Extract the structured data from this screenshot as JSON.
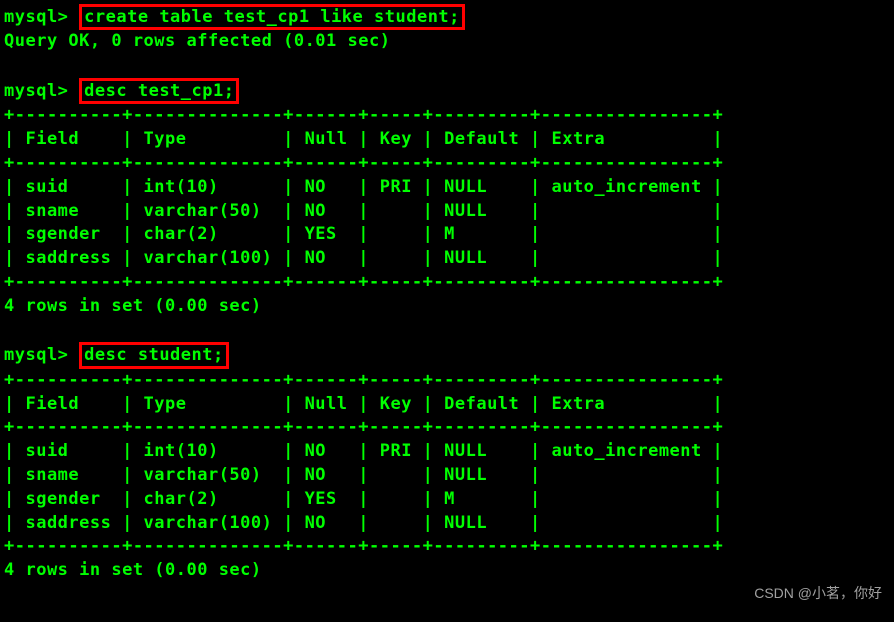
{
  "prompt": "mysql>",
  "commands": {
    "cmd1": "create table test_cp1 like student;",
    "cmd2": "desc test_cp1;",
    "cmd3": "desc student;"
  },
  "responses": {
    "query_ok": "Query OK, 0 rows affected (0.01 sec)",
    "rows_in_set": "4 rows in set (0.00 sec)"
  },
  "chart_data": [
    {
      "type": "table",
      "title": "desc test_cp1",
      "columns": [
        "Field",
        "Type",
        "Null",
        "Key",
        "Default",
        "Extra"
      ],
      "rows": [
        [
          "suid",
          "int(10)",
          "NO",
          "PRI",
          "NULL",
          "auto_increment"
        ],
        [
          "sname",
          "varchar(50)",
          "NO",
          "",
          "NULL",
          ""
        ],
        [
          "sgender",
          "char(2)",
          "YES",
          "",
          "M",
          ""
        ],
        [
          "saddress",
          "varchar(100)",
          "NO",
          "",
          "NULL",
          ""
        ]
      ]
    },
    {
      "type": "table",
      "title": "desc student",
      "columns": [
        "Field",
        "Type",
        "Null",
        "Key",
        "Default",
        "Extra"
      ],
      "rows": [
        [
          "suid",
          "int(10)",
          "NO",
          "PRI",
          "NULL",
          "auto_increment"
        ],
        [
          "sname",
          "varchar(50)",
          "NO",
          "",
          "NULL",
          ""
        ],
        [
          "sgender",
          "char(2)",
          "YES",
          "",
          "M",
          ""
        ],
        [
          "saddress",
          "varchar(100)",
          "NO",
          "",
          "NULL",
          ""
        ]
      ]
    }
  ],
  "table_lines": {
    "border": "+----------+--------------+------+-----+---------+----------------+",
    "header": "| Field    | Type         | Null | Key | Default | Extra          |",
    "row0": "| suid     | int(10)      | NO   | PRI | NULL    | auto_increment |",
    "row1": "| sname    | varchar(50)  | NO   |     | NULL    |                |",
    "row2": "| sgender  | char(2)      | YES  |     | M       |                |",
    "row3": "| saddress | varchar(100) | NO   |     | NULL    |                |"
  },
  "watermark": "CSDN @小茗，你好"
}
